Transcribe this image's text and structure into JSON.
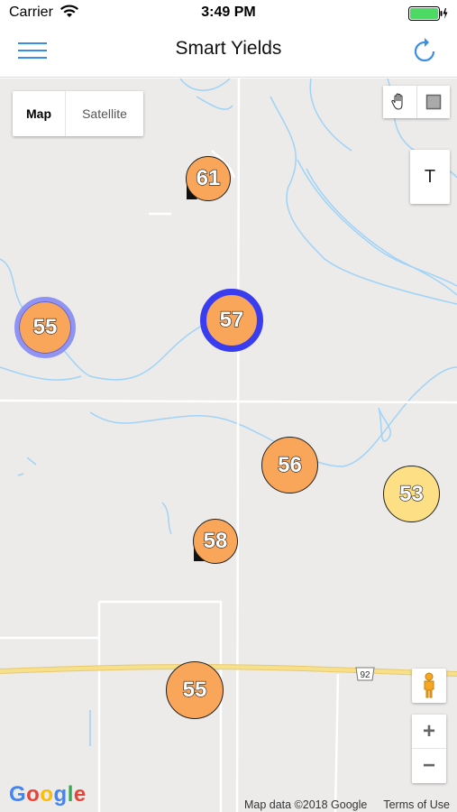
{
  "status": {
    "carrier": "Carrier",
    "time": "3:49 PM"
  },
  "nav": {
    "title": "Smart Yields"
  },
  "map_type": {
    "map": "Map",
    "satellite": "Satellite"
  },
  "controls": {
    "text_tool": "T",
    "zoom_in": "+",
    "zoom_out": "−"
  },
  "clusters": [
    {
      "label": "61",
      "color": "#f9a65a"
    },
    {
      "label": "55",
      "color": "#f9a65a",
      "ring_color": "#8f93f3"
    },
    {
      "label": "57",
      "color": "#f9a65a",
      "ring_color": "#3a3cf0"
    },
    {
      "label": "56",
      "color": "#f9a65a"
    },
    {
      "label": "53",
      "color": "#fddf86"
    },
    {
      "label": "58",
      "color": "#f9a65a"
    },
    {
      "label": "55",
      "color": "#f9a65a"
    }
  ],
  "road_shield": "92",
  "map_footer": {
    "logo": "Google",
    "data": "Map data ©2018 Google",
    "terms": "Terms of Use"
  },
  "colors": {
    "accent": "#3a8ee6",
    "battery": "#4cd964",
    "water": "#9fd3f7",
    "road_major": "#f7e08a"
  }
}
